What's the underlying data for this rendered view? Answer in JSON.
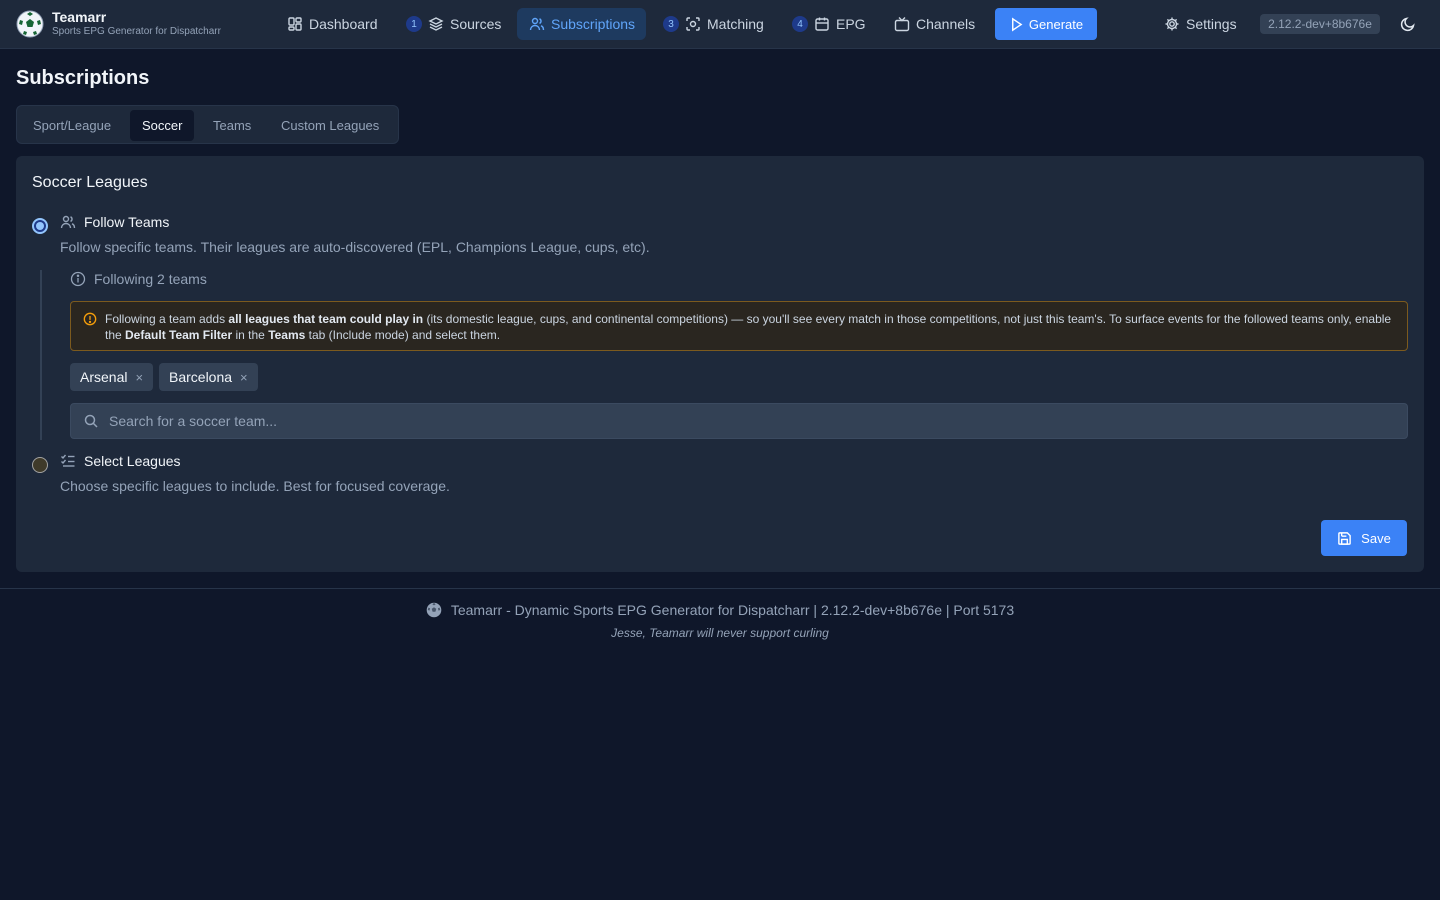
{
  "app": {
    "title": "Teamarr",
    "subtitle": "Sports EPG Generator for Dispatcharr",
    "logo_icon": "soccer-ball-icon"
  },
  "nav": {
    "items": [
      {
        "label": "Dashboard",
        "icon": "dashboard-icon"
      },
      {
        "step": "1",
        "label": "Sources",
        "icon": "layers-icon"
      },
      {
        "label": "Subscriptions",
        "icon": "users-icon",
        "active": true
      },
      {
        "step": "3",
        "label": "Matching",
        "icon": "scan-icon"
      },
      {
        "step": "4",
        "label": "EPG",
        "icon": "calendar-icon"
      },
      {
        "label": "Channels",
        "icon": "tv-icon"
      }
    ],
    "generate_label": "Generate",
    "settings_label": "Settings",
    "version": "2.12.2-dev+8b676e"
  },
  "colors": {
    "background": "#0f172a",
    "surface": "#1e293b",
    "accent": "#3b82f6",
    "active_text": "#60a5fa",
    "warning_border": "#7c5a1e"
  },
  "page": {
    "title": "Subscriptions",
    "tabs": [
      "Sport/League",
      "Soccer",
      "Teams",
      "Custom Leagues"
    ],
    "active_tab": "Soccer"
  },
  "soccer": {
    "card_title": "Soccer Leagues",
    "follow_teams": {
      "label": "Follow Teams",
      "description": "Follow specific teams. Their leagues are auto-discovered (EPL, Champions League, cups, etc).",
      "selected": true,
      "count_text": "Following 2 teams",
      "warning": {
        "p1": "Following a team adds ",
        "b1": "all leagues that team could play in",
        "p2": " (its domestic league, cups, and continental competitions) — so you'll see every match in those competitions, not just this team's. To surface events for the followed teams only, enable the ",
        "b2": "Default Team Filter",
        "p3": " in the ",
        "b3": "Teams",
        "p4": " tab (Include mode) and select them."
      },
      "teams": [
        "Arsenal",
        "Barcelona"
      ],
      "remove_glyph": "×",
      "search_placeholder": "Search for a soccer team..."
    },
    "select_leagues": {
      "label": "Select Leagues",
      "description": "Choose specific leagues to include. Best for focused coverage.",
      "selected": false
    },
    "save_label": "Save"
  },
  "footer": {
    "text": "Teamarr - Dynamic Sports EPG Generator for Dispatcharr | 2.12.2-dev+8b676e | Port 5173",
    "tagline": "Jesse, Teamarr will never support curling"
  }
}
